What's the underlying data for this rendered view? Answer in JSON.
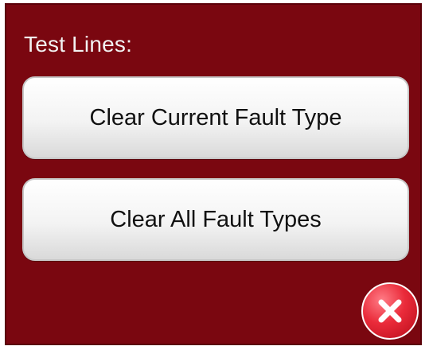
{
  "dialog": {
    "title": "Test Lines:",
    "buttons": [
      {
        "label": "Clear Current Fault Type"
      },
      {
        "label": "Clear All Fault Types"
      }
    ],
    "close_icon": "close-icon"
  },
  "colors": {
    "dialog_background": "#7a0710",
    "button_face": "#f3f3f3",
    "close_button": "#ea2b3a"
  }
}
